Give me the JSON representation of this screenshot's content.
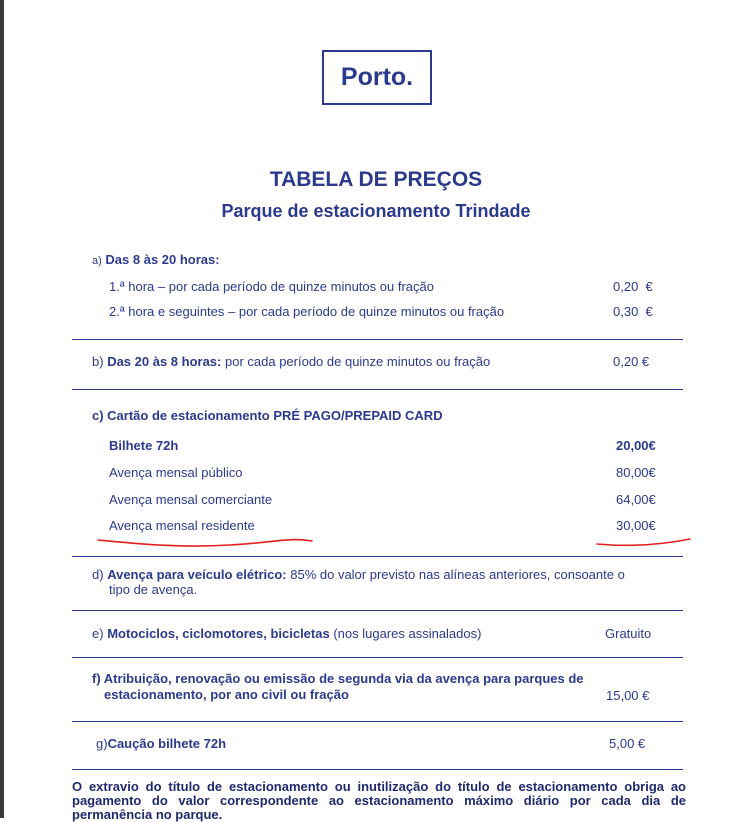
{
  "logo": "Porto.",
  "title": "TABELA DE PREÇOS",
  "subtitle": "Parque de estacionamento Trindade",
  "section_a": {
    "letter": "a)",
    "heading": "Das 8 às 20 horas:",
    "rows": [
      {
        "label": "1.ª hora – por cada período de quinze minutos ou fração",
        "price": "0,20  €"
      },
      {
        "label": "2.ª hora e seguintes – por cada período de quinze minutos ou fração",
        "price": "0,30  €"
      }
    ]
  },
  "section_b": {
    "letter": "b)",
    "heading": "Das 20 às 8 horas:",
    "text": " por cada período de quinze minutos ou fração",
    "price": "0,20 €"
  },
  "section_c": {
    "heading": "c) Cartão de estacionamento PRÉ PAGO/PREPAID CARD",
    "rows": [
      {
        "label": "Bilhete 72h",
        "price": "20,00€"
      },
      {
        "label": "Avença mensal público",
        "price": "80,00€"
      },
      {
        "label": "Avença mensal comerciante",
        "price": "64,00€"
      },
      {
        "label": "Avença mensal residente",
        "price": "30,00€"
      }
    ]
  },
  "section_d": {
    "letter": "d)",
    "heading": "Avença para veículo elétrico:",
    "text": " 85% do valor previsto nas alíneas anteriores, consoante o",
    "text2": "tipo de avença."
  },
  "section_e": {
    "letter": "e)",
    "heading": "Motociclos, ciclomotores, bicicletas",
    "text": " (nos lugares assinalados)",
    "price": "Gratuito"
  },
  "section_f": {
    "line1": "f) Atribuição, renovação ou emissão de segunda via da avença para parques de",
    "line2": "estacionamento, por ano civil ou fração",
    "price": "15,00 €"
  },
  "section_g": {
    "letter": "g)",
    "heading": "Caução bilhete 72h",
    "price": "5,00 €"
  },
  "footer": "O extravio do título de estacionamento ou inutilização do título de estacionamento obriga ao pagamento do valor correspondente ao estacionamento máximo diário por cada dia de permanência no parque.",
  "colors": {
    "text": "#2b3a8c",
    "underline": "#e02020"
  }
}
